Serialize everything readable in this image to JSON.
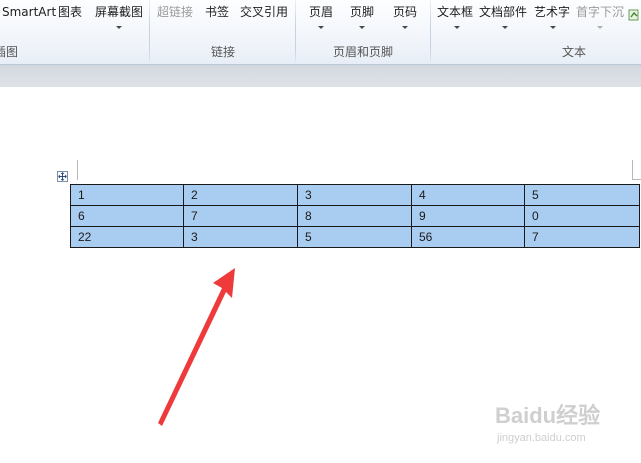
{
  "ribbon": {
    "illustrations": {
      "smartart": "SmartArt",
      "chart": "图表",
      "screenshot": "屏幕截图",
      "group_label": "插图"
    },
    "links": {
      "hyperlink": "超链接",
      "bookmark": "书签",
      "cross_reference": "交叉引用",
      "group_label": "链接"
    },
    "header_footer": {
      "header": "页眉",
      "footer": "页脚",
      "page_number": "页码",
      "group_label": "页眉和页脚"
    },
    "text": {
      "text_box": "文本框",
      "quick_parts": "文档部件",
      "wordart": "艺术字",
      "drop_cap": "首字下沉",
      "group_label": "文本"
    }
  },
  "table": {
    "rows": [
      [
        "1",
        "2",
        "3",
        "4",
        "5"
      ],
      [
        "6",
        "7",
        "8",
        "9",
        "0"
      ],
      [
        "22",
        "3",
        "5",
        "56",
        "7"
      ]
    ]
  },
  "watermark": {
    "brand": "Baidu经验",
    "url": "jingyan.baidu.com"
  },
  "colors": {
    "selection": "#a9cdf0",
    "arrow": "#ee3a3a",
    "ribbon_bg": "#f3f6fb"
  }
}
